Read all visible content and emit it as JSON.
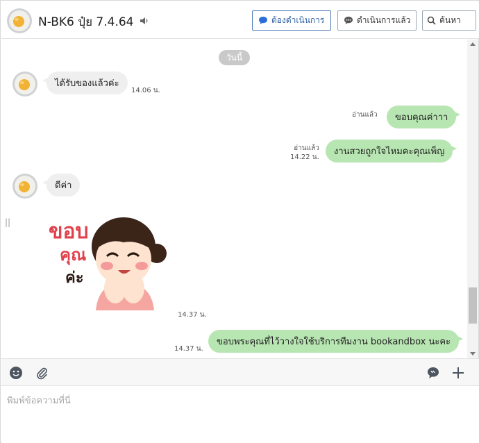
{
  "header": {
    "title": "N-BK6 ปุ๋ย 7.4.64",
    "buttons": {
      "todo_label": "ต้องดำเนินการ",
      "done_label": "ดำเนินการแล้ว",
      "search_label": "ค้นหา"
    }
  },
  "chat": {
    "date_separator": "วันนี้",
    "messages": [
      {
        "side": "in",
        "text": "ได้รับของแล้วค่ะ",
        "time": "14.06 น."
      },
      {
        "side": "out",
        "text": "ขอบคุณค่าาา",
        "read": "อ่านแล้ว"
      },
      {
        "side": "out",
        "text": "งานสวยถูกใจไหมคะคุณเพ็ญ",
        "read": "อ่านแล้ว",
        "time": "14.22 น."
      },
      {
        "side": "in",
        "text": "ดีค่า"
      },
      {
        "side": "in",
        "type": "sticker",
        "sticker_text": [
          "ขอบ",
          "คุณ",
          "ค่ะ"
        ],
        "time": "14.37 น."
      },
      {
        "side": "out",
        "text": "ขอบพระคุณที่ไว้วางใจใช้บริการทีมงาน bookandbox นะคะ",
        "time": "14.37 น."
      }
    ]
  },
  "composer": {
    "placeholder": "พิมพ์ข้อความที่นี่",
    "value": ""
  },
  "colors": {
    "outgoing_bubble": "#b8e6b2",
    "incoming_bubble": "#efefef",
    "todo_button_accent": "#2b5ea3"
  },
  "icons": [
    "speaker-icon",
    "chat-bubble-icon",
    "comment-icon",
    "search-icon",
    "emoji-icon",
    "attachment-icon",
    "line-icon",
    "plus-icon"
  ]
}
